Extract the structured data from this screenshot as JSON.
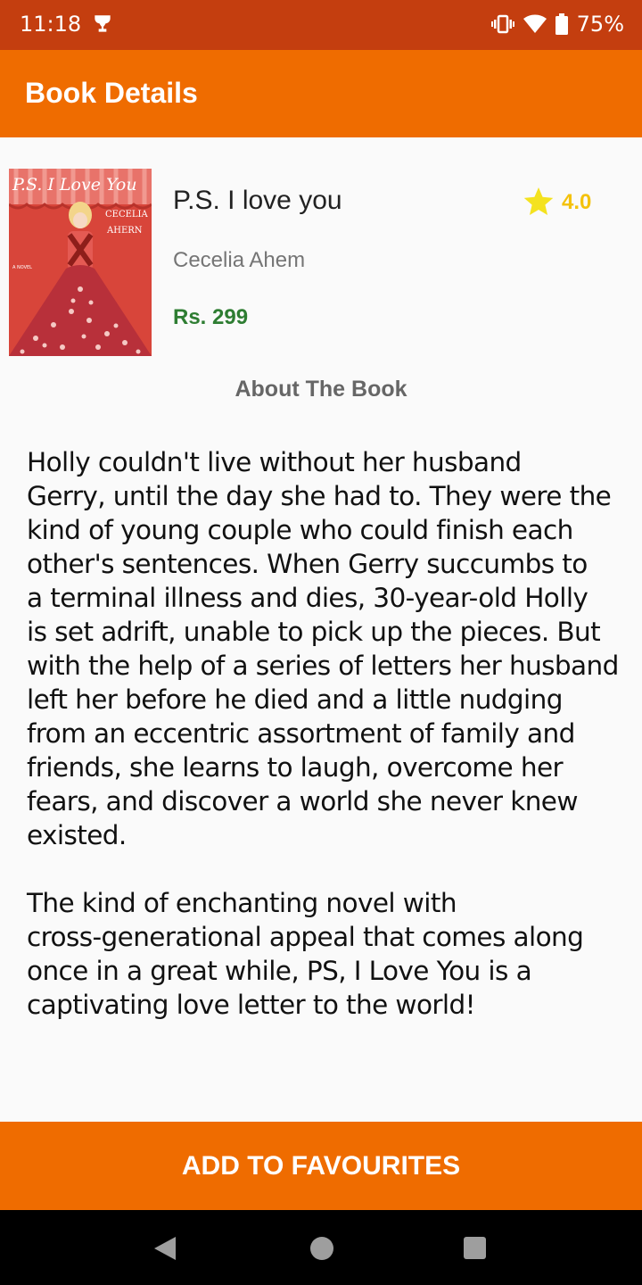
{
  "status_bar": {
    "time": "11:18",
    "battery": "75%",
    "icons": [
      "trophy-icon",
      "vibrate-icon",
      "wifi-icon",
      "battery-icon"
    ]
  },
  "app_bar": {
    "title": "Book Details"
  },
  "book": {
    "cover_text": {
      "title": "P.S. I Love You",
      "author_line1": "CECELIA",
      "author_line2": "AHERN",
      "tag": "A NOVEL"
    },
    "title": "P.S. I love you",
    "rating": "4.0",
    "author": "Cecelia Ahem",
    "price": "Rs. 299"
  },
  "about": {
    "heading": "About The Book",
    "paragraph1": "Holly couldn't live without her husband\nGerry, until the day she had to. They were the\nkind of young couple who could finish each\nother's sentences. When Gerry succumbs to\na terminal illness and dies, 30-year-old Holly\nis set adrift, unable to pick up the pieces. But\nwith the help of a series of letters her husband\nleft her before he died and a little nudging\nfrom an eccentric assortment of family and\nfriends, she learns to laugh, overcome her\nfears, and discover a world she never knew\nexisted.",
    "paragraph2": "The kind of enchanting novel with\ncross-generational appeal that comes along\nonce in a great while, PS, I Love You is a\ncaptivating love letter to the world!"
  },
  "actions": {
    "add_favourites": "ADD TO FAVOURITES"
  },
  "colors": {
    "status_bar": "#c43e0f",
    "app_bar": "#ef6c00",
    "rating": "#f4c20d",
    "price": "#2e7d32"
  }
}
